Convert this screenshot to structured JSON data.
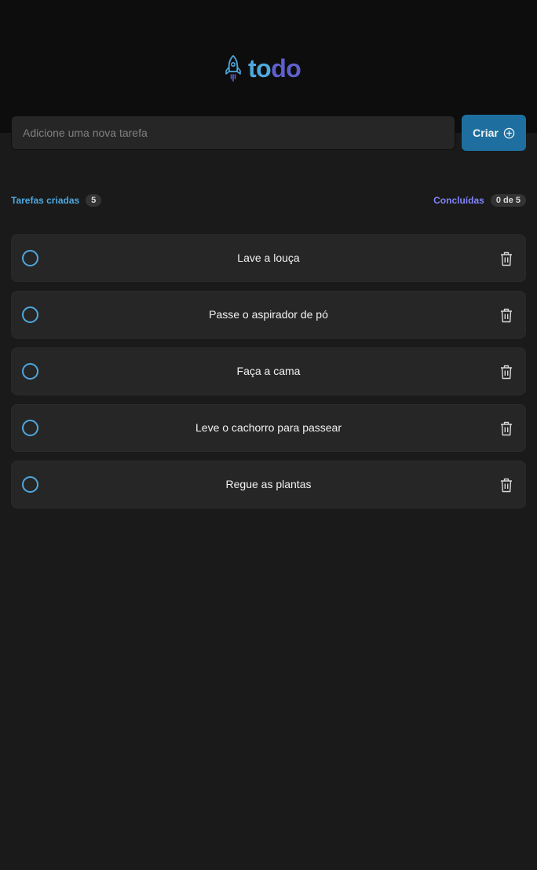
{
  "app": {
    "logo_part1": "to",
    "logo_part2": "do",
    "accent_blue": "#4ea8de",
    "accent_purple": "#5e60ce",
    "button_color": "#1e6f9f"
  },
  "new_task": {
    "placeholder": "Adicione uma nova tarefa",
    "value": "",
    "create_label": "Criar",
    "create_icon": "plus-circle-icon"
  },
  "summary": {
    "created_label": "Tarefas criadas",
    "created_count": "5",
    "done_label": "Concluídas",
    "done_count": "0 de 5"
  },
  "tasks": [
    {
      "text": "Lave a louça",
      "done": false
    },
    {
      "text": "Passe o aspirador de pó",
      "done": false
    },
    {
      "text": "Faça a cama",
      "done": false
    },
    {
      "text": "Leve o cachorro para passear",
      "done": false
    },
    {
      "text": "Regue as plantas",
      "done": false
    }
  ]
}
